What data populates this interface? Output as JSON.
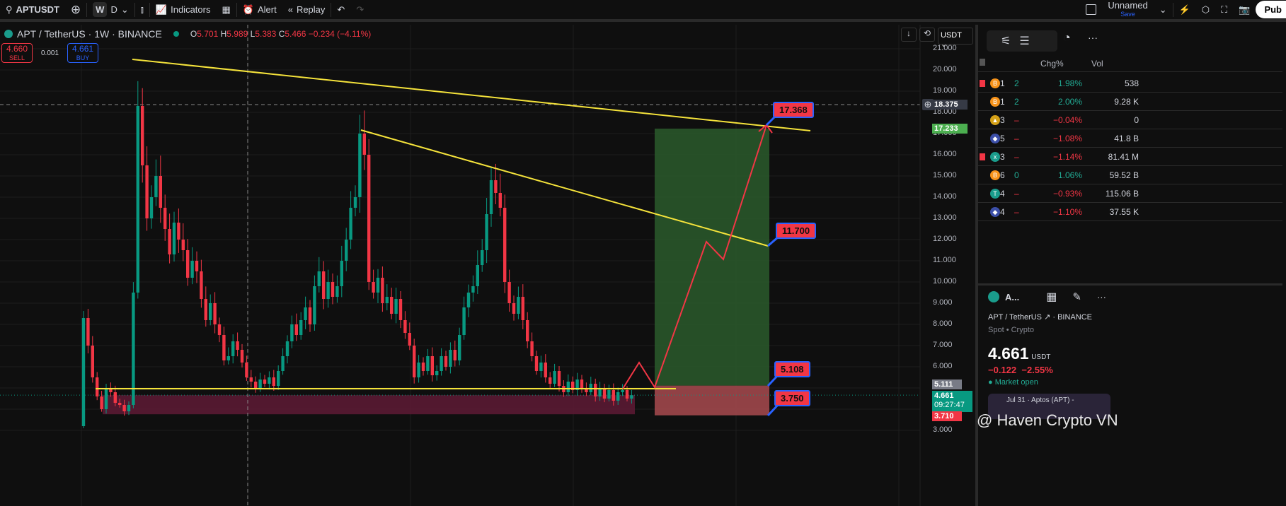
{
  "toolbar": {
    "symbol": "APTUSDT",
    "interval_w": "W",
    "interval_d": "D",
    "indicators": "Indicators",
    "alert": "Alert",
    "replay": "Replay",
    "layout_name": "Unnamed",
    "save": "Save",
    "publish": "Pub"
  },
  "legend": {
    "title": "APT / TetherUS · 1W · BINANCE",
    "o_label": "O",
    "o": "5.701",
    "h_label": "H",
    "h": "5.989",
    "l_label": "L",
    "l": "5.383",
    "c_label": "C",
    "c": "5.466",
    "change": "−0.234 (−4.11%)"
  },
  "trade": {
    "sell_price": "4.660",
    "sell": "SELL",
    "spread": "0.001",
    "buy_price": "4.661",
    "buy": "BUY"
  },
  "chart_controls": {
    "currency": "USDT"
  },
  "price_axis": {
    "ticks": [
      "21.000",
      "20.000",
      "19.000",
      "18.000",
      "17.000",
      "16.000",
      "15.000",
      "14.000",
      "13.000",
      "12.000",
      "11.000",
      "10.000",
      "9.000",
      "8.000",
      "7.000",
      "6.000",
      "5.000",
      "4.000",
      "3.000"
    ],
    "crosshair": "18.375",
    "target": "17.233",
    "entry": "5.111",
    "last": "4.661",
    "countdown": "09:27:47",
    "stop": "3.710"
  },
  "annotations": [
    "17.368",
    "11.700",
    "5.108",
    "3.750"
  ],
  "colors": {
    "up": "#089981",
    "down": "#f23645",
    "trendline": "#f5e33b",
    "profit": "#2a5a2c",
    "loss": "#a84a4f"
  },
  "chart_data": {
    "type": "candlestick",
    "scale": "price",
    "ylim": [
      3,
      21
    ],
    "first_open": 3.2,
    "closes": [
      8.3,
      7.0,
      5.5,
      4.6,
      4.0,
      5.0,
      4.8,
      4.3,
      4.2,
      3.9,
      4.2,
      9.5,
      18.3,
      15.5,
      13,
      14,
      15,
      13.5,
      12.5,
      11.3,
      12.8,
      12,
      11.5,
      10.2,
      11,
      10.5,
      9.2,
      8.2,
      9,
      8,
      7.5,
      6.3,
      6.5,
      7.2,
      6.8,
      6.2,
      5.5,
      5.3,
      5.0,
      5.4,
      5.2,
      5.5,
      5.1,
      5.8,
      6.5,
      7.2,
      8,
      7.5,
      8.2,
      8.8,
      8.0,
      9.8,
      10.5,
      9.2,
      10,
      9.3,
      9.8,
      11,
      12,
      13.5,
      14,
      17,
      16,
      10,
      9.5,
      10.2,
      9,
      9.3,
      8.5,
      9.2,
      8.2,
      7.6,
      7.0,
      5.5,
      6.2,
      5.8,
      6.5,
      5.6,
      5.8,
      6.5,
      6.0,
      6.8,
      6.3,
      7.5,
      8.8,
      9.5,
      9.8,
      10.8,
      11.5,
      13.2,
      14.8,
      14.2,
      13.5,
      10,
      9,
      8.5,
      9.3,
      8.2,
      7.2,
      6.5,
      5.8,
      6.2,
      5.5,
      5.2,
      5.8,
      5.1,
      4.8,
      5.3,
      4.9,
      5.4,
      5.0,
      4.8,
      5.2,
      4.6,
      5.0,
      4.5,
      4.9,
      4.4,
      4.8,
      4.9,
      4.5,
      4.66
    ]
  },
  "watchlist": {
    "headers": {
      "chg": "Chg%",
      "vol": "Vol"
    },
    "rows": [
      {
        "sym": "1",
        "last": "2",
        "chg": "1.98%",
        "vol": "538",
        "up": true,
        "coin": "B",
        "color": "#f7931a",
        "flag": true
      },
      {
        "sym": "1",
        "last": "2",
        "chg": "2.00%",
        "vol": "9.28 K",
        "up": true,
        "coin": "B",
        "color": "#f7931a",
        "flag": false
      },
      {
        "sym": "3",
        "last": "–",
        "chg": "−0.04%",
        "vol": "0",
        "up": false,
        "coin": "▲",
        "color": "#d4a017",
        "flag": false
      },
      {
        "sym": "5",
        "last": "–",
        "chg": "−1.08%",
        "vol": "41.8 B",
        "up": false,
        "coin": "◆",
        "color": "#3c4fa8",
        "flag": false
      },
      {
        "sym": "3",
        "last": "–",
        "chg": "−1.14%",
        "vol": "81.41 M",
        "up": false,
        "coin": "x",
        "color": "#1a9c8c",
        "flag": true
      },
      {
        "sym": "6",
        "last": "0",
        "chg": "1.06%",
        "vol": "59.52 B",
        "up": true,
        "coin": "B",
        "color": "#f7931a",
        "flag": false
      },
      {
        "sym": "4",
        "last": "–",
        "chg": "−0.93%",
        "vol": "115.06 B",
        "up": false,
        "coin": "T",
        "color": "#1a9c8c",
        "flag": false
      },
      {
        "sym": "4",
        "last": "–",
        "chg": "−1.10%",
        "vol": "37.55 K",
        "up": false,
        "coin": "◆",
        "color": "#3c4fa8",
        "flag": false
      }
    ]
  },
  "details": {
    "short": "A...",
    "pair": "APT / TetherUS",
    "exchange": "BINANCE",
    "type": "Spot",
    "category": "Crypto",
    "price": "4.661",
    "currency": "USDT",
    "change": "−0.122",
    "change_pct": "−2.55%",
    "status": "Market open",
    "news": "Jul 31 · Aptos (APT) -"
  },
  "watermark": "@ Haven Crypto VN"
}
